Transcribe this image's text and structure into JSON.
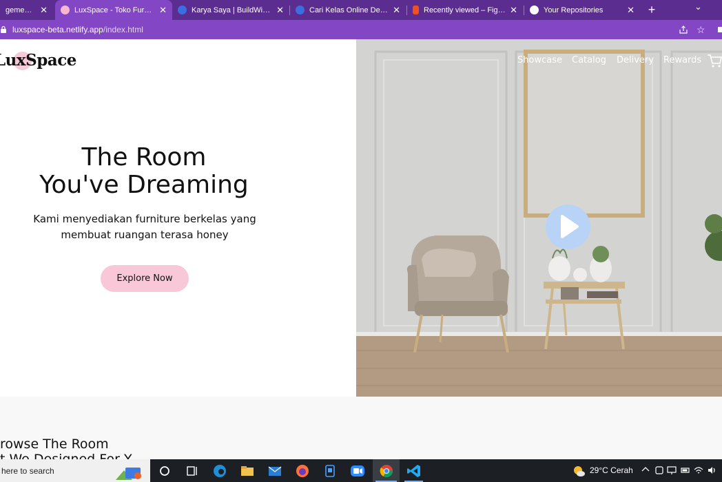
{
  "browser": {
    "tabs": [
      {
        "title": "gement | Site",
        "favicon_color": "#ffffff"
      },
      {
        "title": "LuxSpace - Toko Furniture I",
        "favicon_color": "#f6b7d0"
      },
      {
        "title": "Karya Saya | BuildWith Angg",
        "favicon_color": "#3b6fe0"
      },
      {
        "title": "Cari Kelas Online Design &",
        "favicon_color": "#3b6fe0"
      },
      {
        "title": "Recently viewed – Figma",
        "favicon_color": "#f24e1e"
      },
      {
        "title": "Your Repositories",
        "favicon_color": "#ffffff"
      }
    ],
    "close_glyph": "✕",
    "new_tab_glyph": "+",
    "tab_menu_glyph": "⌄",
    "url_host": "luxspace-beta.netlify.app",
    "url_path": "/index.html",
    "star_glyph": "☆"
  },
  "page": {
    "logo": "LuxSpace",
    "nav": [
      "Showcase",
      "Catalog",
      "Delivery",
      "Rewards"
    ],
    "hero_title_line1": "The Room",
    "hero_title_line2": "You've Dreaming",
    "hero_subtitle_line1": "Kami menyediakan furniture berkelas yang",
    "hero_subtitle_line2": "membuat ruangan terasa honey",
    "cta_label": "Explore Now",
    "section_title": "rowse The Room",
    "section_subtitle": "t We Designed For Y"
  },
  "taskbar": {
    "search_text": "here to search",
    "weather_text": "29°C  Cerah",
    "weather_icon": "sun-cloud-icon",
    "apps": [
      "search-circle",
      "task-view",
      "edge",
      "file-explorer",
      "mail",
      "firefox",
      "app-blue",
      "zoom",
      "chrome",
      "vscode"
    ]
  },
  "colors": {
    "tabbar": "#5b2d90",
    "active_tab": "#8346c4",
    "accent_pink": "#f8c8d8",
    "play_button": "#b9d3f7"
  }
}
